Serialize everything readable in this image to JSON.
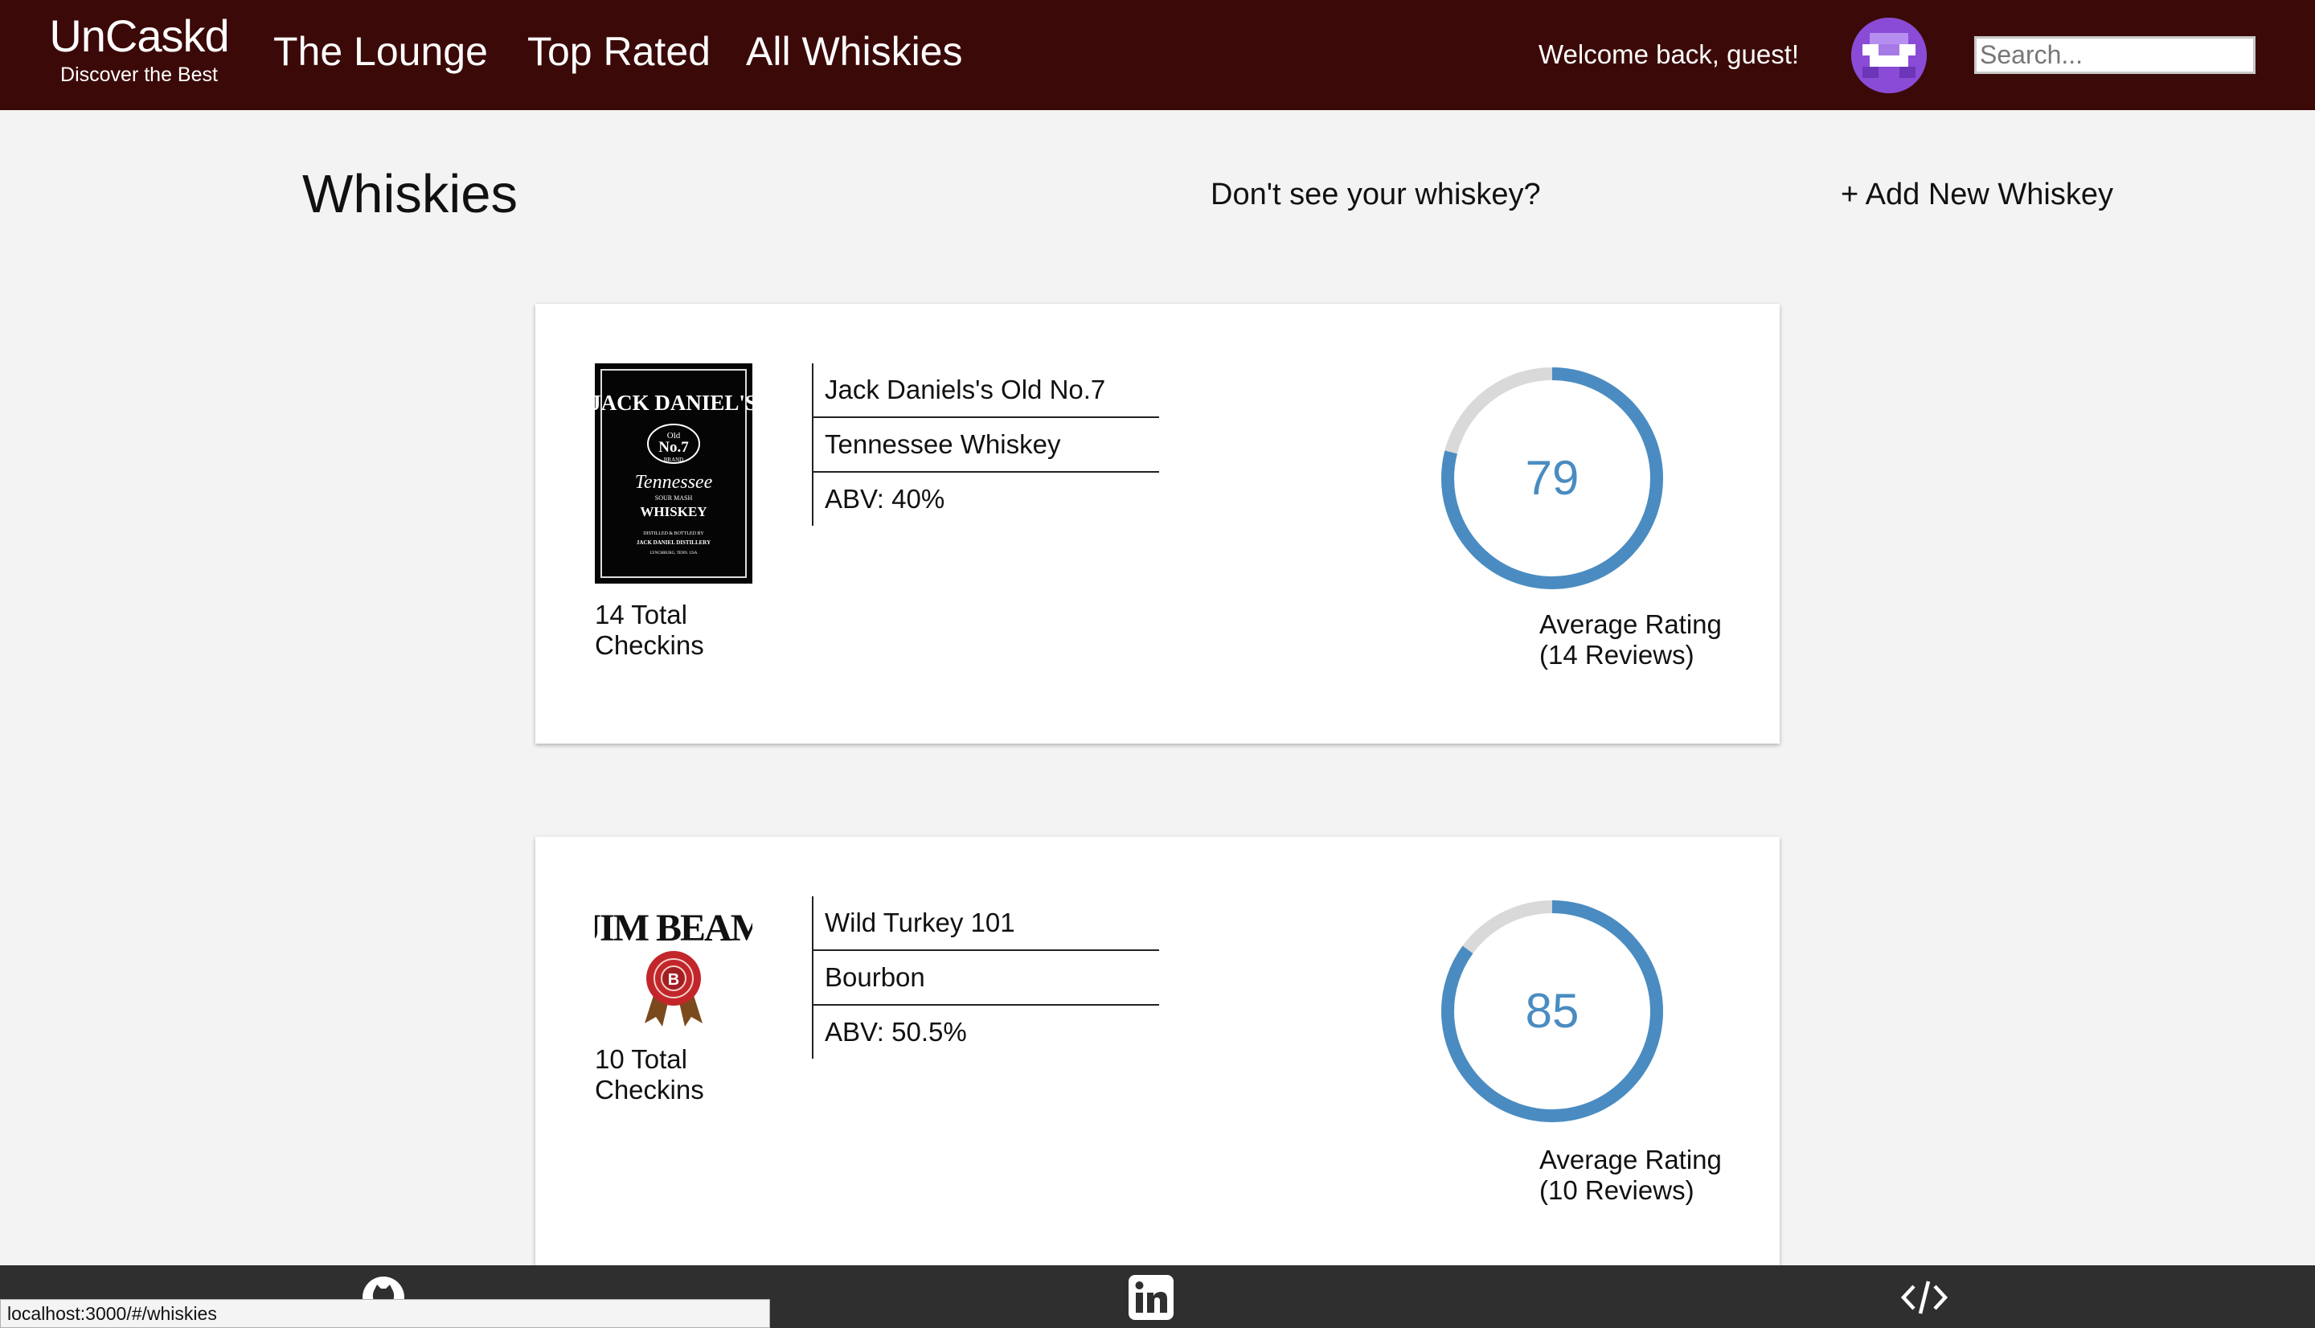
{
  "nav": {
    "brand": "UnCaskd",
    "tagline": "Discover the Best",
    "links": [
      "The Lounge",
      "Top Rated",
      "All Whiskies"
    ],
    "welcome": "Welcome back, guest!",
    "search_placeholder": "Search..."
  },
  "header": {
    "title": "Whiskies",
    "prompt": "Don't see your whiskey?",
    "add_link": "+ Add New Whiskey"
  },
  "whiskies": [
    {
      "image_icon": "jack-daniels-label",
      "image_text": [
        "JACK DANIEL'S",
        "Old",
        "No.7",
        "BRAND",
        "Tennessee",
        "SOUR MASH",
        "WHISKEY",
        "DISTILLED & BOTTLED BY",
        "JACK DANIEL DISTILLERY",
        "LYNCHBURG, TENN. USA"
      ],
      "checkins_line1": "14 Total",
      "checkins_line2": "Checkins",
      "name": "Jack Daniels's Old No.7",
      "style": "Tennessee Whiskey",
      "abv": "ABV: 40%",
      "rating": "79",
      "rating_fraction": 0.79,
      "rating_label": "Average Rating",
      "reviews": "(14 Reviews)"
    },
    {
      "image_icon": "jim-beam-logo",
      "image_text": [
        "JIM BEAM",
        "B"
      ],
      "checkins_line1": "10 Total",
      "checkins_line2": "Checkins",
      "name": "Wild Turkey 101",
      "style": "Bourbon",
      "abv": "ABV: 50.5%",
      "rating": "85",
      "rating_fraction": 0.85,
      "rating_label": "Average Rating",
      "reviews": "(10 Reviews)"
    }
  ],
  "footer": {
    "icons": [
      "github-icon",
      "linkedin-icon",
      "code-icon"
    ]
  },
  "status_url": "localhost:3000/#/whiskies",
  "colors": {
    "navbar": "#3b0a08",
    "ring": "#4a8cc1",
    "ring_track": "#d9d9d9",
    "footer": "#2f2f2f"
  }
}
